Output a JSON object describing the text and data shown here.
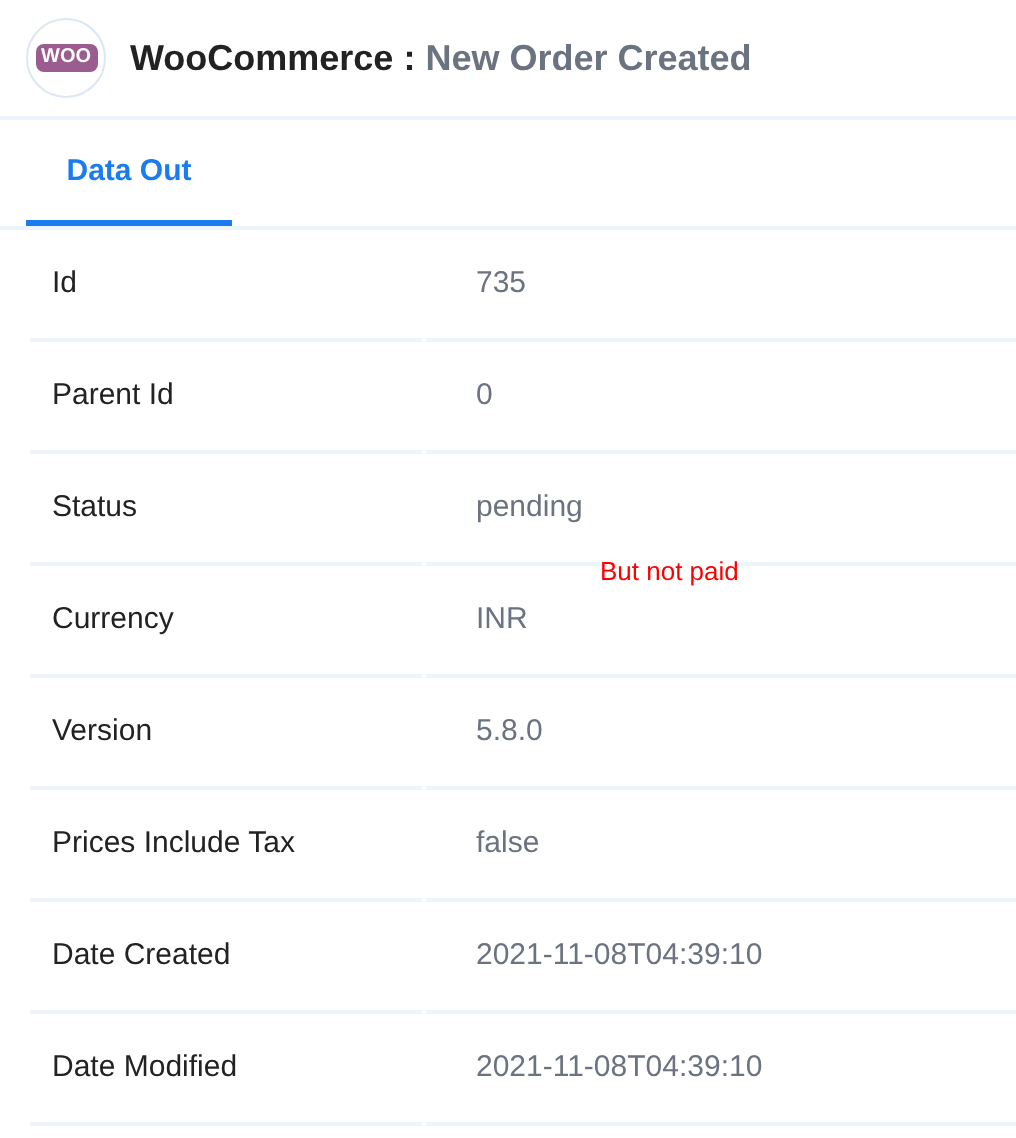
{
  "header": {
    "app_logo": "WOO",
    "app_name": "WooCommerce :",
    "trigger": "New Order Created"
  },
  "tabs": [
    {
      "label": "Data Out",
      "selected": true
    }
  ],
  "rows": [
    {
      "label": "Id",
      "value": "735"
    },
    {
      "label": "Parent Id",
      "value": "0"
    },
    {
      "label": "Status",
      "value": "pending"
    },
    {
      "label": "Currency",
      "value": "INR"
    },
    {
      "label": "Version",
      "value": "5.8.0"
    },
    {
      "label": "Prices Include Tax",
      "value": "false"
    },
    {
      "label": "Date Created",
      "value": "2021-11-08T04:39:10"
    },
    {
      "label": "Date Modified",
      "value": "2021-11-08T04:39:10"
    }
  ],
  "annotation": "But not paid"
}
